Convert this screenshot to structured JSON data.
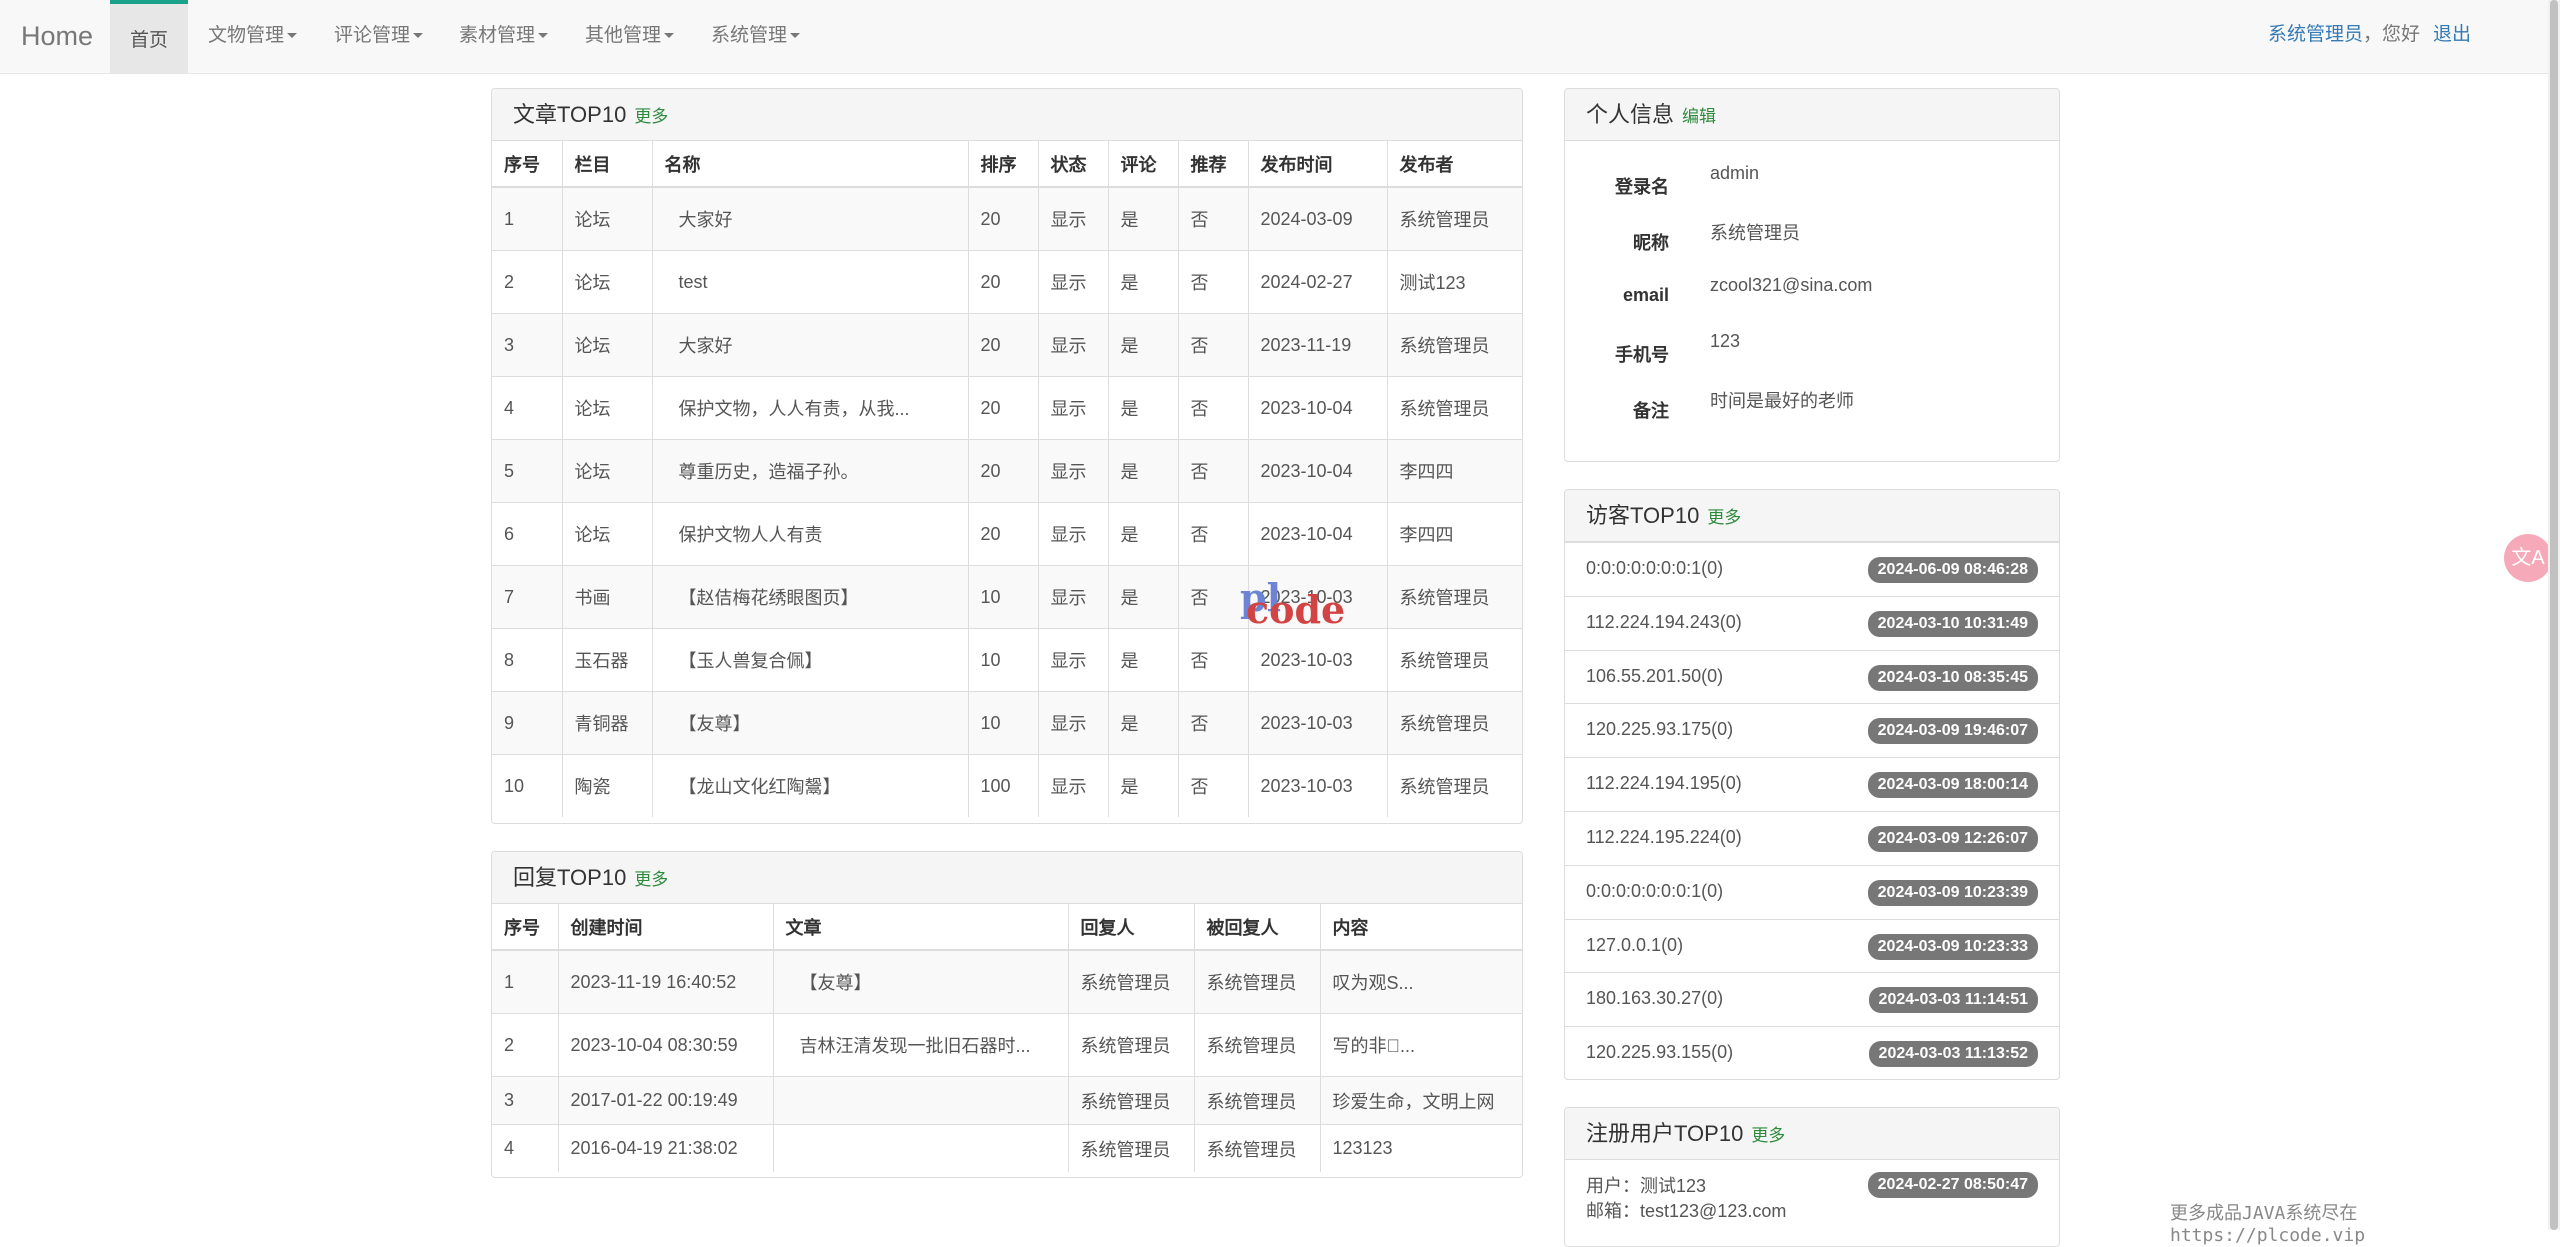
{
  "nav": {
    "brand": "Home",
    "active": "首页",
    "menus": [
      "文物管理",
      "评论管理",
      "素材管理",
      "其他管理",
      "系统管理"
    ],
    "user": "系统管理员",
    "greeting": "，您好",
    "logout": "退出"
  },
  "articles": {
    "title": "文章TOP10",
    "more": "更多",
    "headers": [
      "序号",
      "栏目",
      "名称",
      "排序",
      "状态",
      "评论",
      "推荐",
      "发布时间",
      "发布者"
    ],
    "rows": [
      [
        "1",
        "论坛",
        "大家好",
        "20",
        "显示",
        "是",
        "否",
        "2024-03-09",
        "系统管理员"
      ],
      [
        "2",
        "论坛",
        "test",
        "20",
        "显示",
        "是",
        "否",
        "2024-02-27",
        "测试123"
      ],
      [
        "3",
        "论坛",
        "大家好",
        "20",
        "显示",
        "是",
        "否",
        "2023-11-19",
        "系统管理员"
      ],
      [
        "4",
        "论坛",
        "保护文物，人人有责，从我...",
        "20",
        "显示",
        "是",
        "否",
        "2023-10-04",
        "系统管理员"
      ],
      [
        "5",
        "论坛",
        "尊重历史，造福子孙。",
        "20",
        "显示",
        "是",
        "否",
        "2023-10-04",
        "李四四"
      ],
      [
        "6",
        "论坛",
        "保护文物人人有责",
        "20",
        "显示",
        "是",
        "否",
        "2023-10-04",
        "李四四"
      ],
      [
        "7",
        "书画",
        "【赵佶梅花绣眼图页】",
        "10",
        "显示",
        "是",
        "否",
        "2023-10-03",
        "系统管理员"
      ],
      [
        "8",
        "玉石器",
        "【玉人兽复合佩】",
        "10",
        "显示",
        "是",
        "否",
        "2023-10-03",
        "系统管理员"
      ],
      [
        "9",
        "青铜器",
        "【友尊】",
        "10",
        "显示",
        "是",
        "否",
        "2023-10-03",
        "系统管理员"
      ],
      [
        "10",
        "陶瓷",
        "【龙山文化红陶鬶】",
        "100",
        "显示",
        "是",
        "否",
        "2023-10-03",
        "系统管理员"
      ]
    ]
  },
  "replies": {
    "title": "回复TOP10",
    "more": "更多",
    "headers": [
      "序号",
      "创建时间",
      "文章",
      "回复人",
      "被回复人",
      "内容"
    ],
    "rows": [
      [
        "1",
        "2023-11-19 16:40:52",
        "【友尊】",
        "系统管理员",
        "系统管理员",
        "叹为观S..."
      ],
      [
        "2",
        "2023-10-04 08:30:59",
        "吉林汪清发现一批旧石器时...",
        "系统管理员",
        "系统管理员",
        "写的非\u0000..."
      ],
      [
        "3",
        "2017-01-22 00:19:49",
        "",
        "系统管理员",
        "系统管理员",
        "珍爱生命，文明上网"
      ],
      [
        "4",
        "2016-04-19 21:38:02",
        "",
        "系统管理员",
        "系统管理员",
        "123123"
      ]
    ]
  },
  "profile": {
    "title": "个人信息",
    "edit": "编辑",
    "fields": [
      {
        "label": "登录名",
        "value": "admin"
      },
      {
        "label": "昵称",
        "value": "系统管理员"
      },
      {
        "label": "email",
        "value": "zcool321@sina.com"
      },
      {
        "label": "手机号",
        "value": "123"
      },
      {
        "label": "备注",
        "value": "时间是最好的老师"
      }
    ]
  },
  "visitors": {
    "title": "访客TOP10",
    "more": "更多",
    "items": [
      {
        "ip": "0:0:0:0:0:0:0:1(0)",
        "time": "2024-06-09 08:46:28"
      },
      {
        "ip": "112.224.194.243(0)",
        "time": "2024-03-10 10:31:49"
      },
      {
        "ip": "106.55.201.50(0)",
        "time": "2024-03-10 08:35:45"
      },
      {
        "ip": "120.225.93.175(0)",
        "time": "2024-03-09 19:46:07"
      },
      {
        "ip": "112.224.194.195(0)",
        "time": "2024-03-09 18:00:14"
      },
      {
        "ip": "112.224.195.224(0)",
        "time": "2024-03-09 12:26:07"
      },
      {
        "ip": "0:0:0:0:0:0:0:1(0)",
        "time": "2024-03-09 10:23:39"
      },
      {
        "ip": "127.0.0.1(0)",
        "time": "2024-03-09 10:23:33"
      },
      {
        "ip": "180.163.30.27(0)",
        "time": "2024-03-03 11:14:51"
      },
      {
        "ip": "120.225.93.155(0)",
        "time": "2024-03-03 11:13:52"
      }
    ]
  },
  "registered": {
    "title": "注册用户TOP10",
    "more": "更多",
    "user_line": "用户：测试123",
    "email_line": "邮箱：test123@123.com",
    "time": "2024-02-27 08:50:47"
  },
  "watermark": {
    "line1": "pl",
    "line2": "code"
  },
  "footer_note": "更多成品JAVA系统尽在 https://plcode.vip",
  "translate_icon": "文A"
}
